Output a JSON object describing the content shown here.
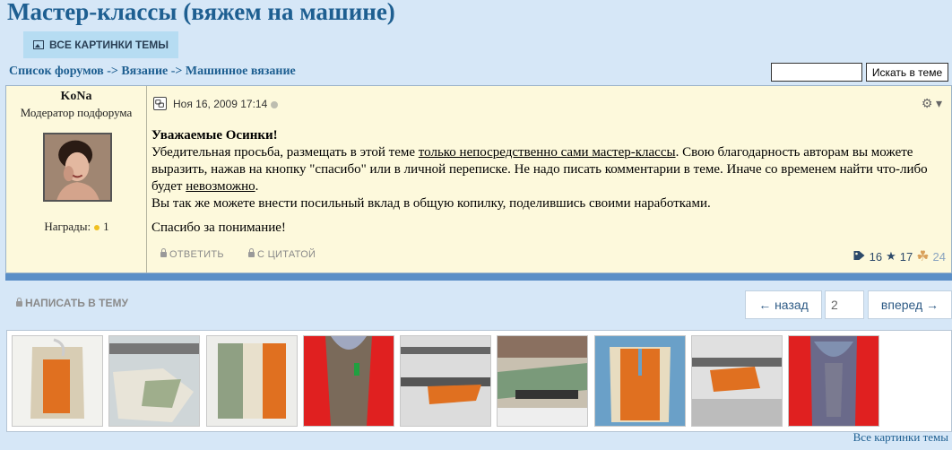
{
  "page": {
    "title": "Мастер-классы (вяжем на машине)"
  },
  "toolbar": {
    "gallery_label": "ВСЕ КАРТИНКИ ТЕМЫ"
  },
  "breadcrumb": {
    "item1": "Список форумов",
    "sep": "->",
    "item2": "Вязание",
    "item3": "Машинное вязание"
  },
  "search": {
    "value": "",
    "button": "Искать в теме"
  },
  "post": {
    "author": "KoNa",
    "role": "Модератор подфорума",
    "awards_label": "Награды:",
    "awards_count": "1",
    "date": "Ноя 16, 2009 17:14",
    "greeting": "Уважаемые Осинки!",
    "line1_a": "Убедительная просьба, размещать в этой теме ",
    "line1_u": "только непосредственно сами мастер-классы",
    "line1_b": ". Свою благодарность авторам вы можете выразить, нажав на кнопку \"спасибо\" или в личной переписке. Не надо писать комментарии в теме. Иначе со временем найти что-либо будет ",
    "line1_u2": "невозможно",
    "line1_c": ".",
    "line2": "Вы так же можете внести посильный вклад в общую копилку, поделившись своими наработками.",
    "thanks": "Спасибо за понимание!",
    "reply": "ОТВЕТИТЬ",
    "quote": "С ЦИТАТОЙ",
    "tags_count": "16",
    "stars_count": "17",
    "karma": "24"
  },
  "topic": {
    "write": "НАПИСАТЬ В ТЕМУ"
  },
  "pager": {
    "prev": "← назад",
    "page": "2",
    "next": "вперед →"
  },
  "gallery": {
    "link": "Все картинки темы"
  },
  "colors": {
    "title": "#1e5f91",
    "post_bg": "#fdf9dc",
    "page_bg": "#d6e7f7",
    "bar": "#5b8fc7"
  }
}
